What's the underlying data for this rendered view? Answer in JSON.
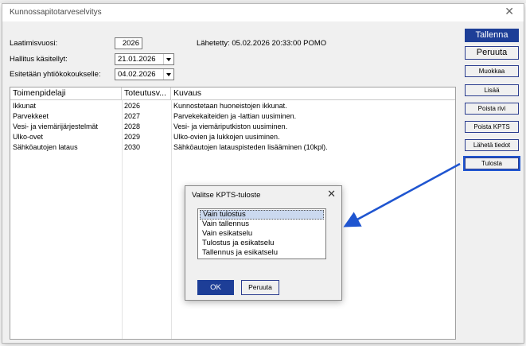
{
  "window": {
    "title": "Kunnossapitotarveselvitys"
  },
  "form": {
    "year_label": "Laatimisvuosi:",
    "year_value": "2026",
    "sent_label": "Lähetetty: 05.02.2026 20:33:00 POMO",
    "board_label": "Hallitus käsitellyt:",
    "board_value": "21.01.2026",
    "meeting_label": "Esitetään yhtiökokoukselle:",
    "meeting_value": "04.02.2026"
  },
  "table": {
    "headers": [
      "Toimenpidelaji",
      "Toteutusv...",
      "Kuvaus"
    ],
    "rows": [
      [
        "Ikkunat",
        "2026",
        "Kunnostetaan huoneistojen ikkunat."
      ],
      [
        "Parvekkeet",
        "2027",
        "Parvekekaiteiden ja -lattian uusiminen."
      ],
      [
        "Vesi- ja viemärijärjestelmät",
        "2028",
        "Vesi- ja viemäriputkiston uusiminen."
      ],
      [
        "Ulko-ovet",
        "2029",
        "Ulko-ovien ja lukkojen uusiminen."
      ],
      [
        "Sähköautojen lataus",
        "2030",
        "Sähköautojen latauspisteden lisääminen (10kpl)."
      ]
    ]
  },
  "buttons": {
    "save": "Tallenna",
    "cancel": "Peruuta",
    "edit": "Muokkaa",
    "add": "Lisää",
    "delete_row": "Poista rivi",
    "delete_kpts": "Poista KPTS",
    "send": "Lähetä tiedot",
    "print": "Tulosta"
  },
  "dialog": {
    "title": "Valitse KPTS-tuloste",
    "options": [
      "Vain tulostus",
      "Vain tallennus",
      "Vain esikatselu",
      "Tulostus ja esikatselu",
      "Tallennus ja esikatselu"
    ],
    "selected_index": 0,
    "ok": "OK",
    "cancel": "Peruuta"
  },
  "colors": {
    "accent": "#1d3e97",
    "arrow": "#1f55d0"
  }
}
